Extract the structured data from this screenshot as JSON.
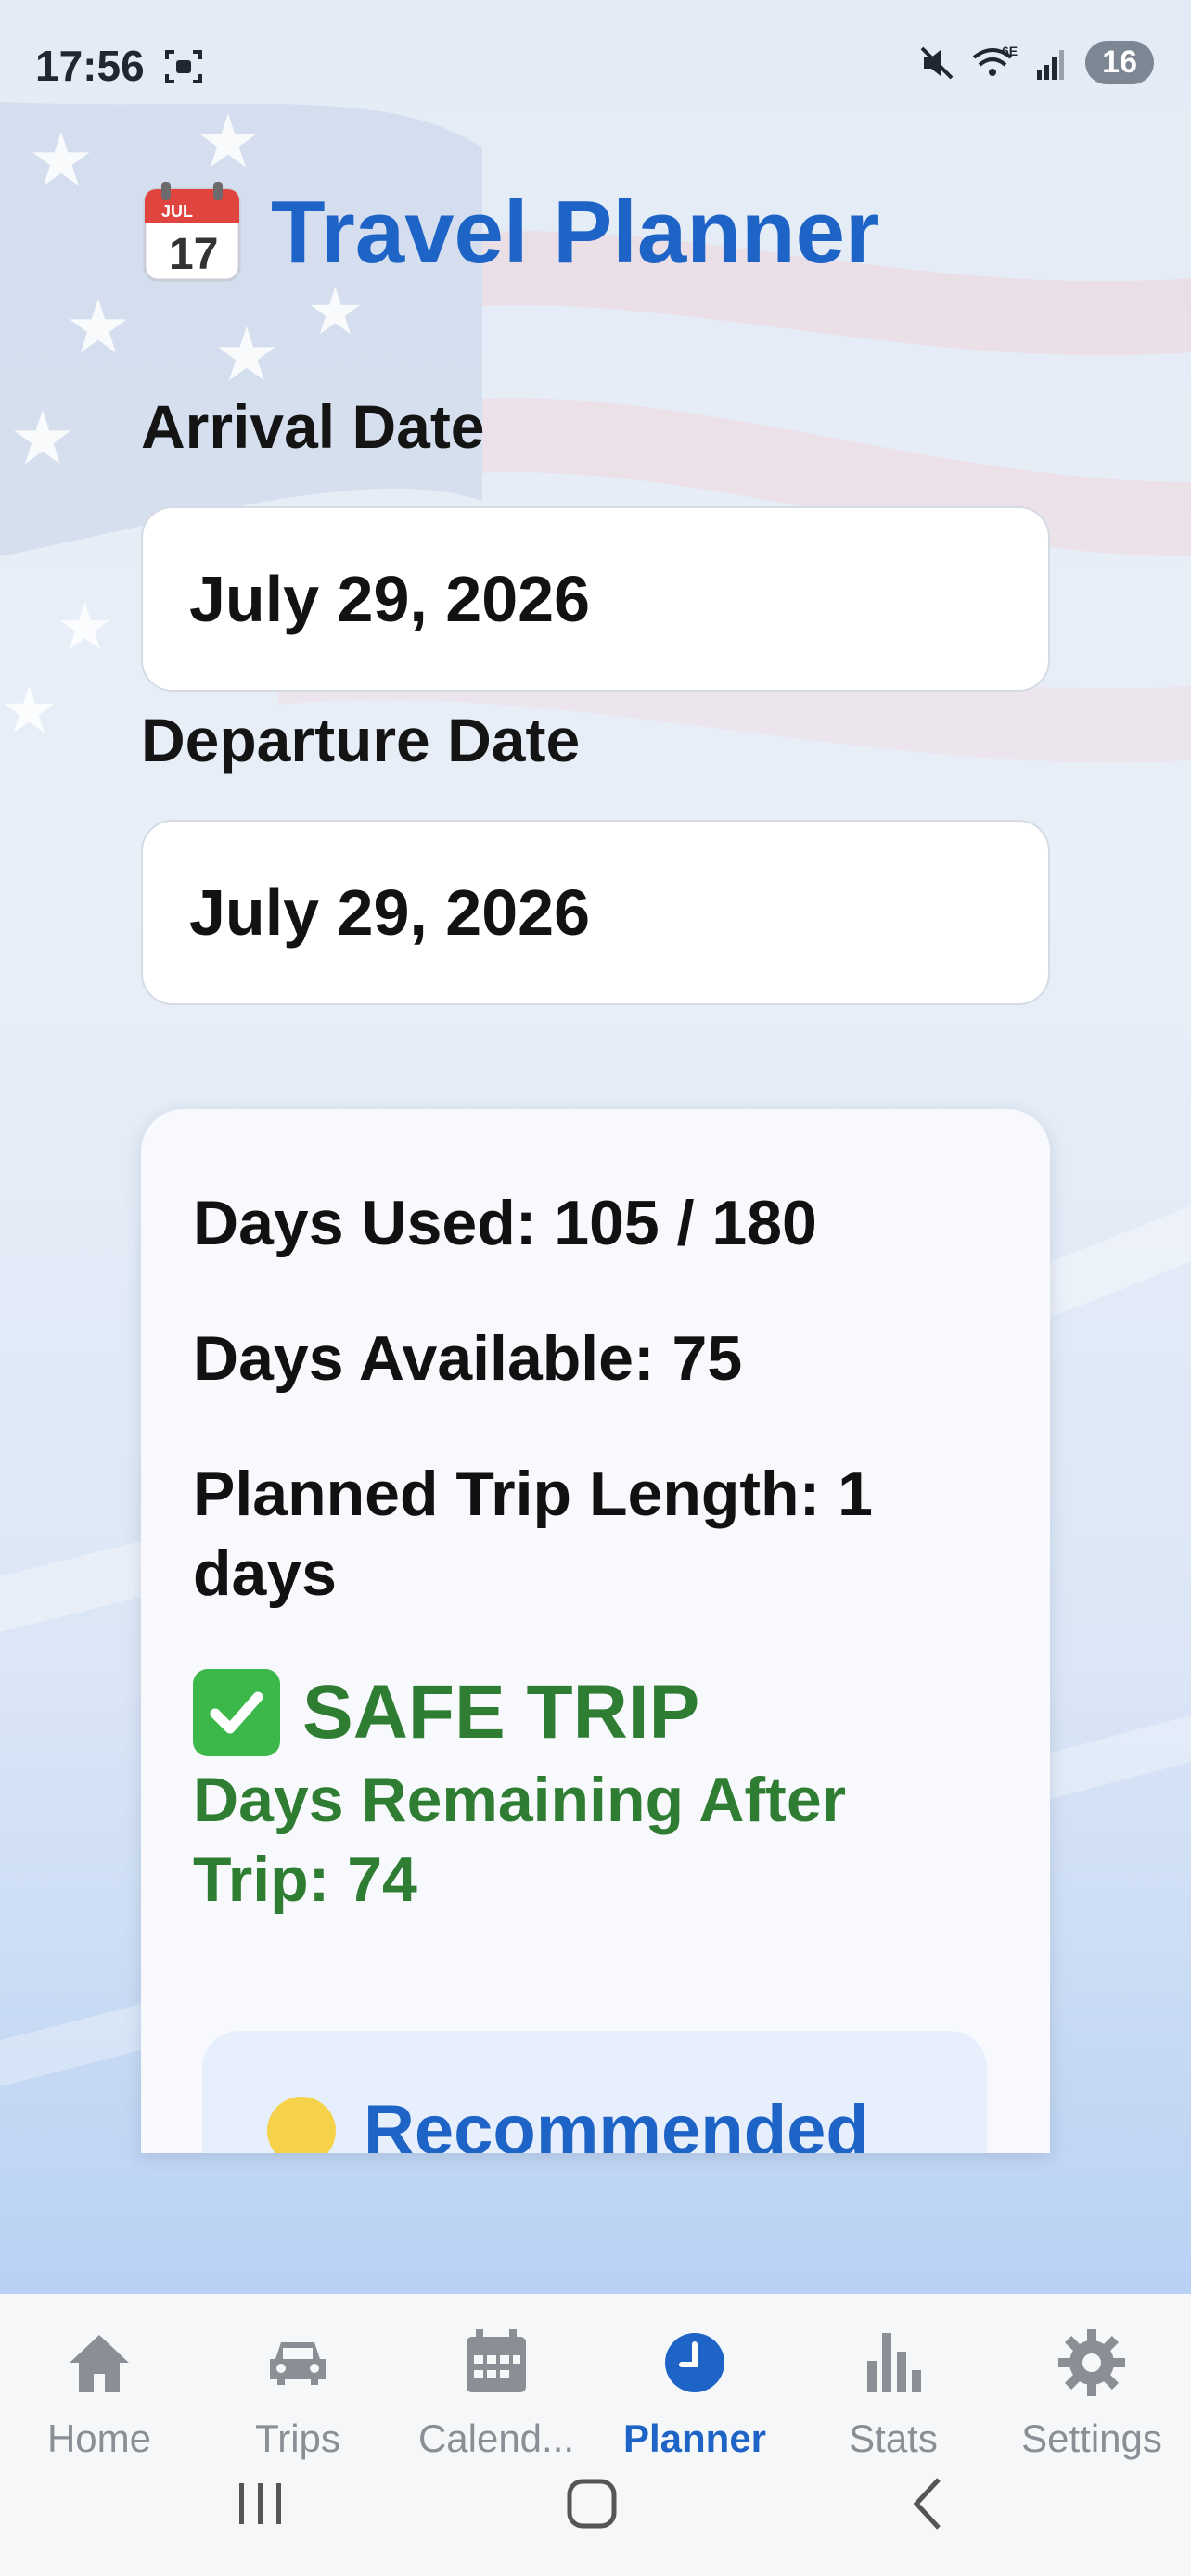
{
  "status_bar": {
    "time": "17:56",
    "battery": "16",
    "network": "6E"
  },
  "header": {
    "title": "Travel Planner",
    "icon": "calendar-icon",
    "icon_month": "JUL",
    "icon_day": "17"
  },
  "form": {
    "arrival_label": "Arrival Date",
    "arrival_value": "July 29, 2026",
    "departure_label": "Departure Date",
    "departure_value": "July 29, 2026"
  },
  "summary": {
    "days_used": "Days Used: 105 / 180",
    "days_available": "Days Available: 75",
    "trip_length": "Planned Trip Length: 1 days",
    "status_title": "SAFE TRIP",
    "status_detail": "Days Remaining After Trip: 74",
    "recommended": "Recommended"
  },
  "bottom_nav": {
    "items": [
      {
        "label": "Home",
        "icon": "home-icon"
      },
      {
        "label": "Trips",
        "icon": "car-icon"
      },
      {
        "label": "Calend...",
        "icon": "calendar-grid-icon"
      },
      {
        "label": "Planner",
        "icon": "clock-icon"
      },
      {
        "label": "Stats",
        "icon": "bar-chart-icon"
      },
      {
        "label": "Settings",
        "icon": "gear-icon"
      }
    ],
    "active_index": 3
  },
  "colors": {
    "accent": "#1e63c6",
    "safe": "#2e7d32",
    "inactive": "#8a8f96"
  }
}
